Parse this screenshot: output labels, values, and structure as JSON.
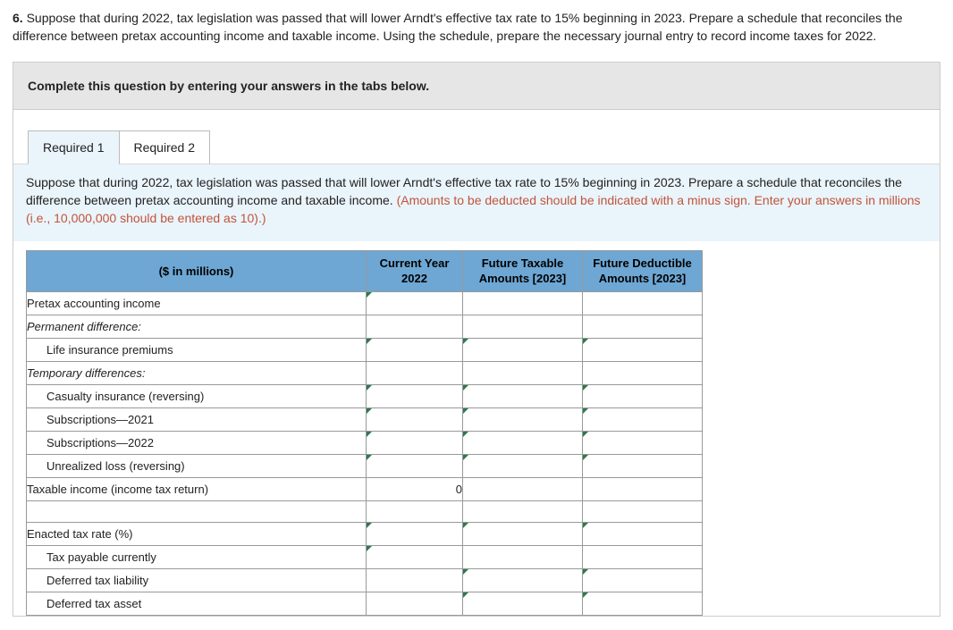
{
  "question": {
    "number": "6.",
    "text": "Suppose that during 2022, tax legislation was passed that will lower Arndt's effective tax rate to 15% beginning in 2023. Prepare a schedule that reconciles the difference between pretax accounting income and taxable income. Using the schedule, prepare the necessary journal entry to record income taxes for 2022."
  },
  "instruction_bar": "Complete this question by entering your answers in the tabs below.",
  "tabs": [
    {
      "label": "Required 1",
      "active": true
    },
    {
      "label": "Required 2",
      "active": false
    }
  ],
  "tab_body": {
    "text": "Suppose that during 2022, tax legislation was passed that will lower Arndt's effective tax rate to 15% beginning in 2023. Prepare a schedule that reconciles the difference between pretax accounting income and taxable income. ",
    "hint": "(Amounts to be deducted should be indicated with a minus sign. Enter your answers in millions (i.e., 10,000,000 should be entered as 10).)"
  },
  "headers": {
    "label": "($ in millions)",
    "cy": "Current Year 2022",
    "ft": "Future Taxable Amounts [2023]",
    "fd": "Future Deductible Amounts [2023]"
  },
  "rows": {
    "pretax": {
      "label": "Pretax accounting income"
    },
    "permdiff": {
      "label": "Permanent difference:"
    },
    "life_ins": {
      "label": "Life insurance premiums"
    },
    "tempdiff": {
      "label": "Temporary differences:"
    },
    "casualty": {
      "label": "Casualty insurance (reversing)"
    },
    "subs21": {
      "label": "Subscriptions—2021"
    },
    "subs22": {
      "label": "Subscriptions—2022"
    },
    "unreal": {
      "label": "Unrealized loss (reversing)"
    },
    "taxable": {
      "label": "Taxable income (income tax return)",
      "cy_value": "0"
    },
    "enacted": {
      "label": "Enacted tax rate (%)"
    },
    "taxpay": {
      "label": "Tax payable currently"
    },
    "dtl": {
      "label": "Deferred tax liability"
    },
    "dta": {
      "label": "Deferred tax asset"
    }
  }
}
